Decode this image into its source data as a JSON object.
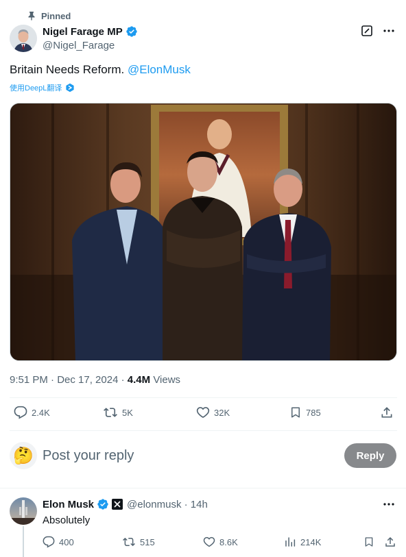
{
  "tweet": {
    "pinned_label": "Pinned",
    "author_name": "Nigel Farage MP",
    "author_handle": "@Nigel_Farage",
    "text": "Britain Needs Reform.",
    "mention": "@ElonMusk",
    "translate_label": "使用DeepL翻译",
    "time": "9:51 PM · Dec 17, 2024",
    "separator": " · ",
    "views_count": "4.4M",
    "views_label": "Views",
    "stats": {
      "replies": "2.4K",
      "reposts": "5K",
      "likes": "32K",
      "bookmarks": "785"
    }
  },
  "reply_composer": {
    "placeholder": "Post your reply",
    "button_label": "Reply",
    "avatar_emoji": "🤔"
  },
  "reply": {
    "author_name": "Elon Musk",
    "author_handle": "@elonmusk · 14h",
    "text": "Absolutely",
    "stats": {
      "replies": "400",
      "reposts": "515",
      "likes": "8.6K",
      "views": "214K"
    }
  },
  "colors": {
    "accent": "#1d9bf0",
    "muted": "#536471",
    "reply_button": "#87898c"
  },
  "icons": [
    "pin-icon",
    "verified-icon",
    "grok-icon",
    "more-icon",
    "deepl-icon",
    "reply-icon",
    "repost-icon",
    "like-icon",
    "bookmark-icon",
    "share-icon",
    "x-affiliate-icon",
    "views-icon"
  ]
}
